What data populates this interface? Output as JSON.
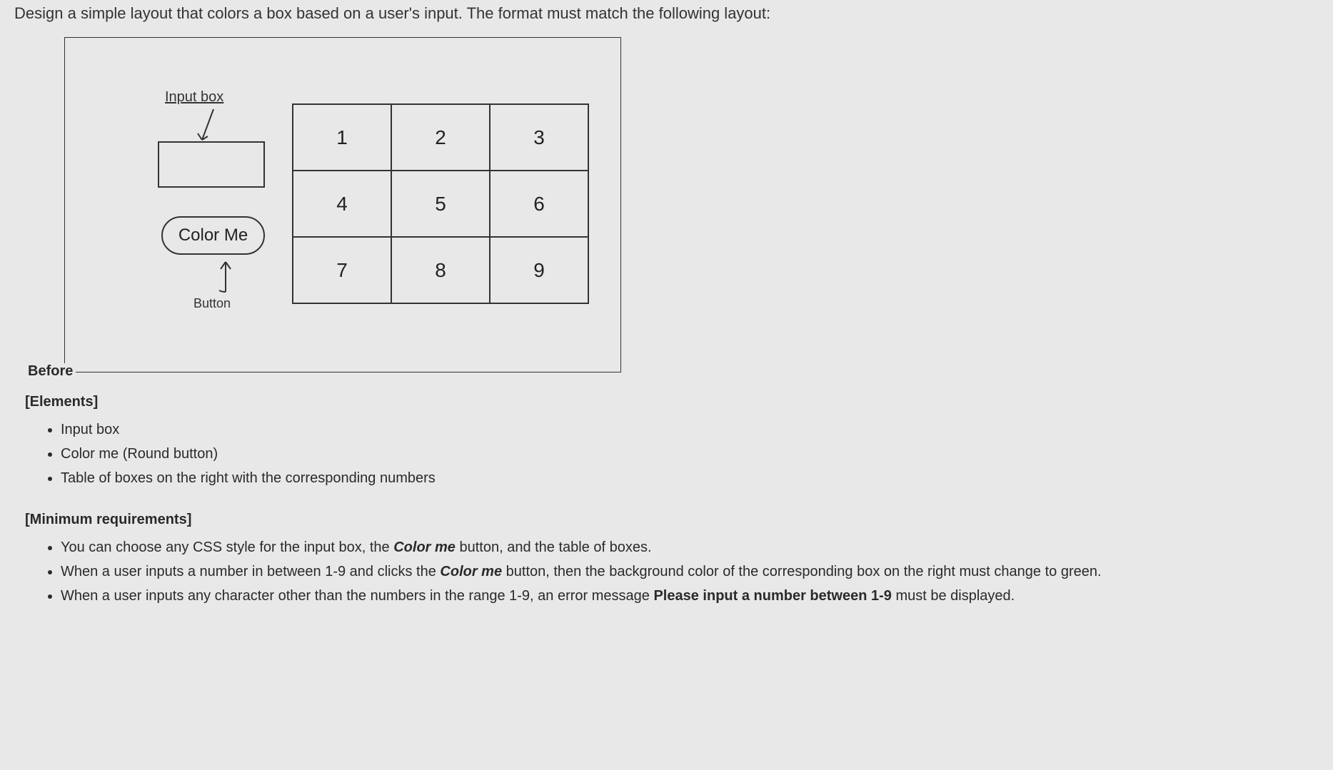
{
  "instruction": "Design a simple layout that colors a box based on a user's input. The format must match the following layout:",
  "figure": {
    "before_label": "Before",
    "input_label": "Input box",
    "button_text": "Color Me",
    "button_caption": "Button",
    "grid": [
      "1",
      "2",
      "3",
      "4",
      "5",
      "6",
      "7",
      "8",
      "9"
    ]
  },
  "elements_heading": "[Elements]",
  "elements_list": [
    "Input box",
    "Color me (Round button)",
    "Table of boxes on the right with the corresponding numbers"
  ],
  "minreq_heading": "[Minimum requirements]",
  "minreq_list": {
    "r1_a": "You can choose any CSS style for the input box, the ",
    "r1_b": "Color me",
    "r1_c": " button, and the table of boxes.",
    "r2_a": "When a user inputs a number in between 1-9 and clicks the ",
    "r2_b": "Color me",
    "r2_c": " button, then the background color of the corresponding box on the right must change to green.",
    "r3_a": "When a user inputs any character other than the numbers in the range 1-9, an error message ",
    "r3_b": "Please input a number between 1-9",
    "r3_c": " must be displayed."
  }
}
